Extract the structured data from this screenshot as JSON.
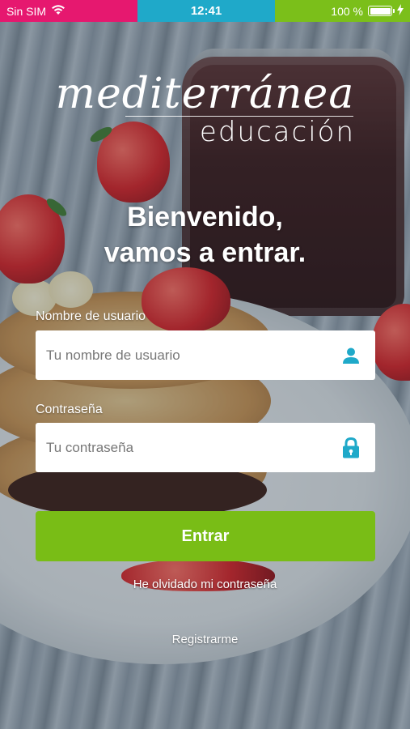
{
  "status_bar": {
    "carrier": "Sin SIM",
    "time": "12:41",
    "battery": "100 %",
    "battery_level": 1.0,
    "colors": {
      "left": "#e6186f",
      "middle": "#1fa9c9",
      "right": "#7bbf1a"
    }
  },
  "logo": {
    "main": "mediterránea",
    "sub": "educación"
  },
  "welcome": {
    "line1": "Bienvenido,",
    "line2": "vamos a entrar."
  },
  "form": {
    "username": {
      "label": "Nombre de usuario",
      "placeholder": "Tu nombre de usuario",
      "value": "",
      "icon": "user-icon"
    },
    "password": {
      "label": "Contraseña",
      "placeholder": "Tu contraseña",
      "value": "",
      "icon": "lock-icon"
    },
    "submit_label": "Entrar",
    "forgot_label": "He olvidado mi contraseña",
    "register_label": "Registrarme"
  },
  "colors": {
    "accent_green": "#79bd16",
    "icon_teal": "#1fa9c9"
  }
}
